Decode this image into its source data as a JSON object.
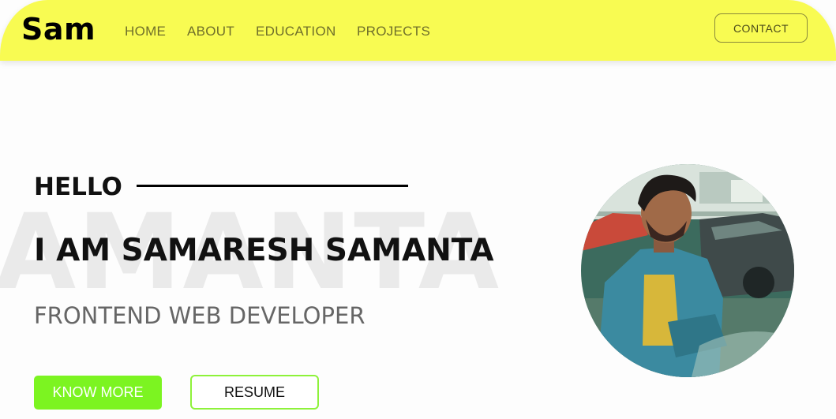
{
  "navbar": {
    "logo": "Sam",
    "links": [
      {
        "label": "HOME"
      },
      {
        "label": "ABOUT"
      },
      {
        "label": "EDUCATION"
      },
      {
        "label": "PROJECTS"
      }
    ],
    "contact_label": "CONTACT"
  },
  "hero": {
    "watermark": "AMANTA",
    "greeting": "HELLO",
    "name": "I AM SAMARESH SAMANTA",
    "role": "FRONTEND WEB DEVELOPER",
    "primary_button": "KNOW MORE",
    "secondary_button": "RESUME"
  },
  "colors": {
    "navbar_bg": "#f8fb52",
    "accent_green": "#7cf421",
    "outline_green": "#8ef23a"
  }
}
